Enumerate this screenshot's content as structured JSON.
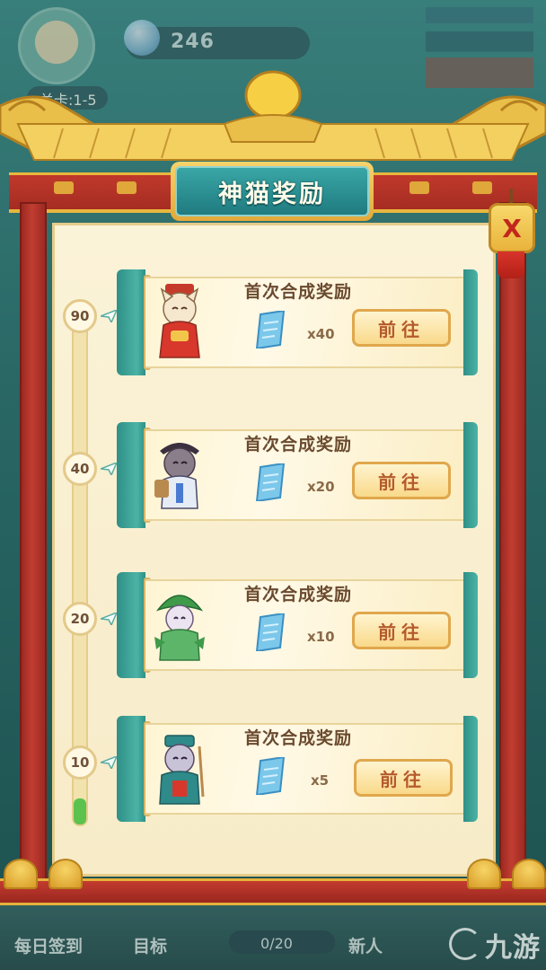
{
  "background": {
    "hud_count": "246",
    "level": "关卡:1-5",
    "bottom_buttons": [
      "每日签到",
      "目标",
      "新人"
    ],
    "task_progress": "0/20",
    "watermark": "九游"
  },
  "modal": {
    "title": "神猫奖励",
    "close_label": "X",
    "rewards": [
      {
        "milestone": "90",
        "title": "首次合成奖励",
        "quantity": "x40",
        "button": "前往",
        "cat_color": "#d8372b"
      },
      {
        "milestone": "40",
        "title": "首次合成奖励",
        "quantity": "x20",
        "button": "前往",
        "cat_color": "#4a4a6a"
      },
      {
        "milestone": "20",
        "title": "首次合成奖励",
        "quantity": "x10",
        "button": "前往",
        "cat_color": "#3f9a4a"
      },
      {
        "milestone": "10",
        "title": "首次合成奖励",
        "quantity": "x5",
        "button": "前往",
        "cat_color": "#2f8a8a"
      }
    ],
    "progress_fraction": 0.05
  },
  "colors": {
    "frame_red": "#c23d31",
    "gold": "#e8b73e",
    "teal": "#2f8f86",
    "progress_green": "#5cc24e"
  }
}
